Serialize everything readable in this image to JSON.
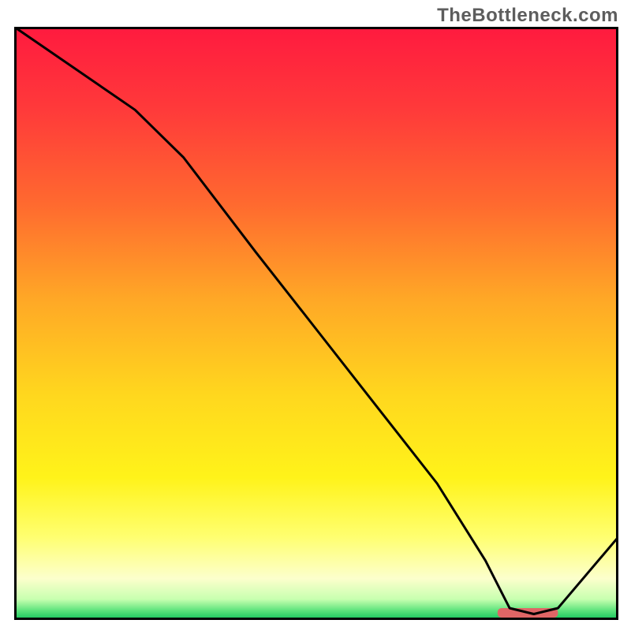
{
  "watermark": "TheBottleneck.com",
  "chart_data": {
    "type": "line",
    "title": "",
    "xlabel": "",
    "ylabel": "",
    "xlim": [
      0,
      100
    ],
    "ylim": [
      0,
      100
    ],
    "grid": false,
    "series": [
      {
        "name": "gradient-background",
        "type": "gradient",
        "stops": [
          {
            "pos": 0.0,
            "color": "#ff1a3f"
          },
          {
            "pos": 0.14,
            "color": "#ff3a3a"
          },
          {
            "pos": 0.3,
            "color": "#ff6a2f"
          },
          {
            "pos": 0.46,
            "color": "#ffa826"
          },
          {
            "pos": 0.62,
            "color": "#ffd71e"
          },
          {
            "pos": 0.76,
            "color": "#fff31a"
          },
          {
            "pos": 0.86,
            "color": "#ffff70"
          },
          {
            "pos": 0.93,
            "color": "#fcffcc"
          },
          {
            "pos": 0.965,
            "color": "#c8ffb0"
          },
          {
            "pos": 0.985,
            "color": "#58e27a"
          },
          {
            "pos": 1.0,
            "color": "#12c25a"
          }
        ]
      },
      {
        "name": "curve",
        "type": "line",
        "color": "#000000",
        "x": [
          0,
          10,
          20,
          28,
          40,
          50,
          60,
          70,
          78,
          82,
          86,
          90,
          100
        ],
        "y": [
          100,
          93,
          86,
          78,
          62,
          49,
          36,
          23,
          10,
          2,
          1,
          2,
          14
        ]
      },
      {
        "name": "marker-bar",
        "type": "bar-segment",
        "color": "#e06666",
        "x_start": 80,
        "x_end": 90,
        "y": 1.2,
        "thickness_pct": 1.6
      }
    ]
  }
}
